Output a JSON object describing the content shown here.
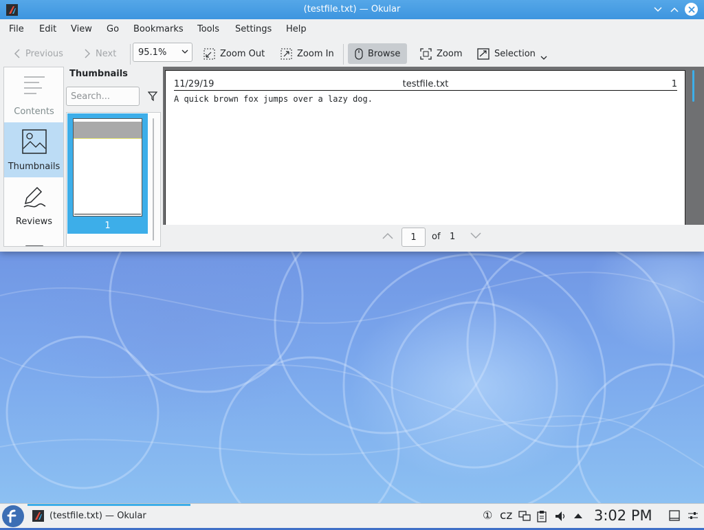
{
  "window": {
    "title": "(testfile.txt) — Okular"
  },
  "menu": [
    "File",
    "Edit",
    "View",
    "Go",
    "Bookmarks",
    "Tools",
    "Settings",
    "Help"
  ],
  "toolbar": {
    "previous": "Previous",
    "next": "Next",
    "zoom_value": "95.1%",
    "zoom_out": "Zoom Out",
    "zoom_in": "Zoom In",
    "browse": "Browse",
    "zoom": "Zoom",
    "selection": "Selection"
  },
  "sidebar": {
    "tabs": [
      {
        "label": "Contents",
        "icon": "contents-icon",
        "selected": false
      },
      {
        "label": "Thumbnails",
        "icon": "thumbnails-icon",
        "selected": true
      },
      {
        "label": "Reviews",
        "icon": "reviews-icon",
        "selected": false
      }
    ]
  },
  "thumbnails": {
    "heading": "Thumbnails",
    "search_placeholder": "Search...",
    "items": [
      {
        "page": "1"
      }
    ]
  },
  "document": {
    "header_date": "11/29/19",
    "header_file": "testfile.txt",
    "header_page": "1",
    "body": "A quick brown fox jumps over a lazy dog."
  },
  "pager": {
    "current": "1",
    "of_label": "of",
    "total": "1"
  },
  "panel": {
    "task_label": "(testfile.txt)  — Okular",
    "tray_badge": "①",
    "keyboard_layout": "cz",
    "clock": "3:02 PM"
  },
  "colors": {
    "accent": "#3daee9",
    "titlebar": "#4a9fe4",
    "window_bg": "#eff0f1"
  }
}
